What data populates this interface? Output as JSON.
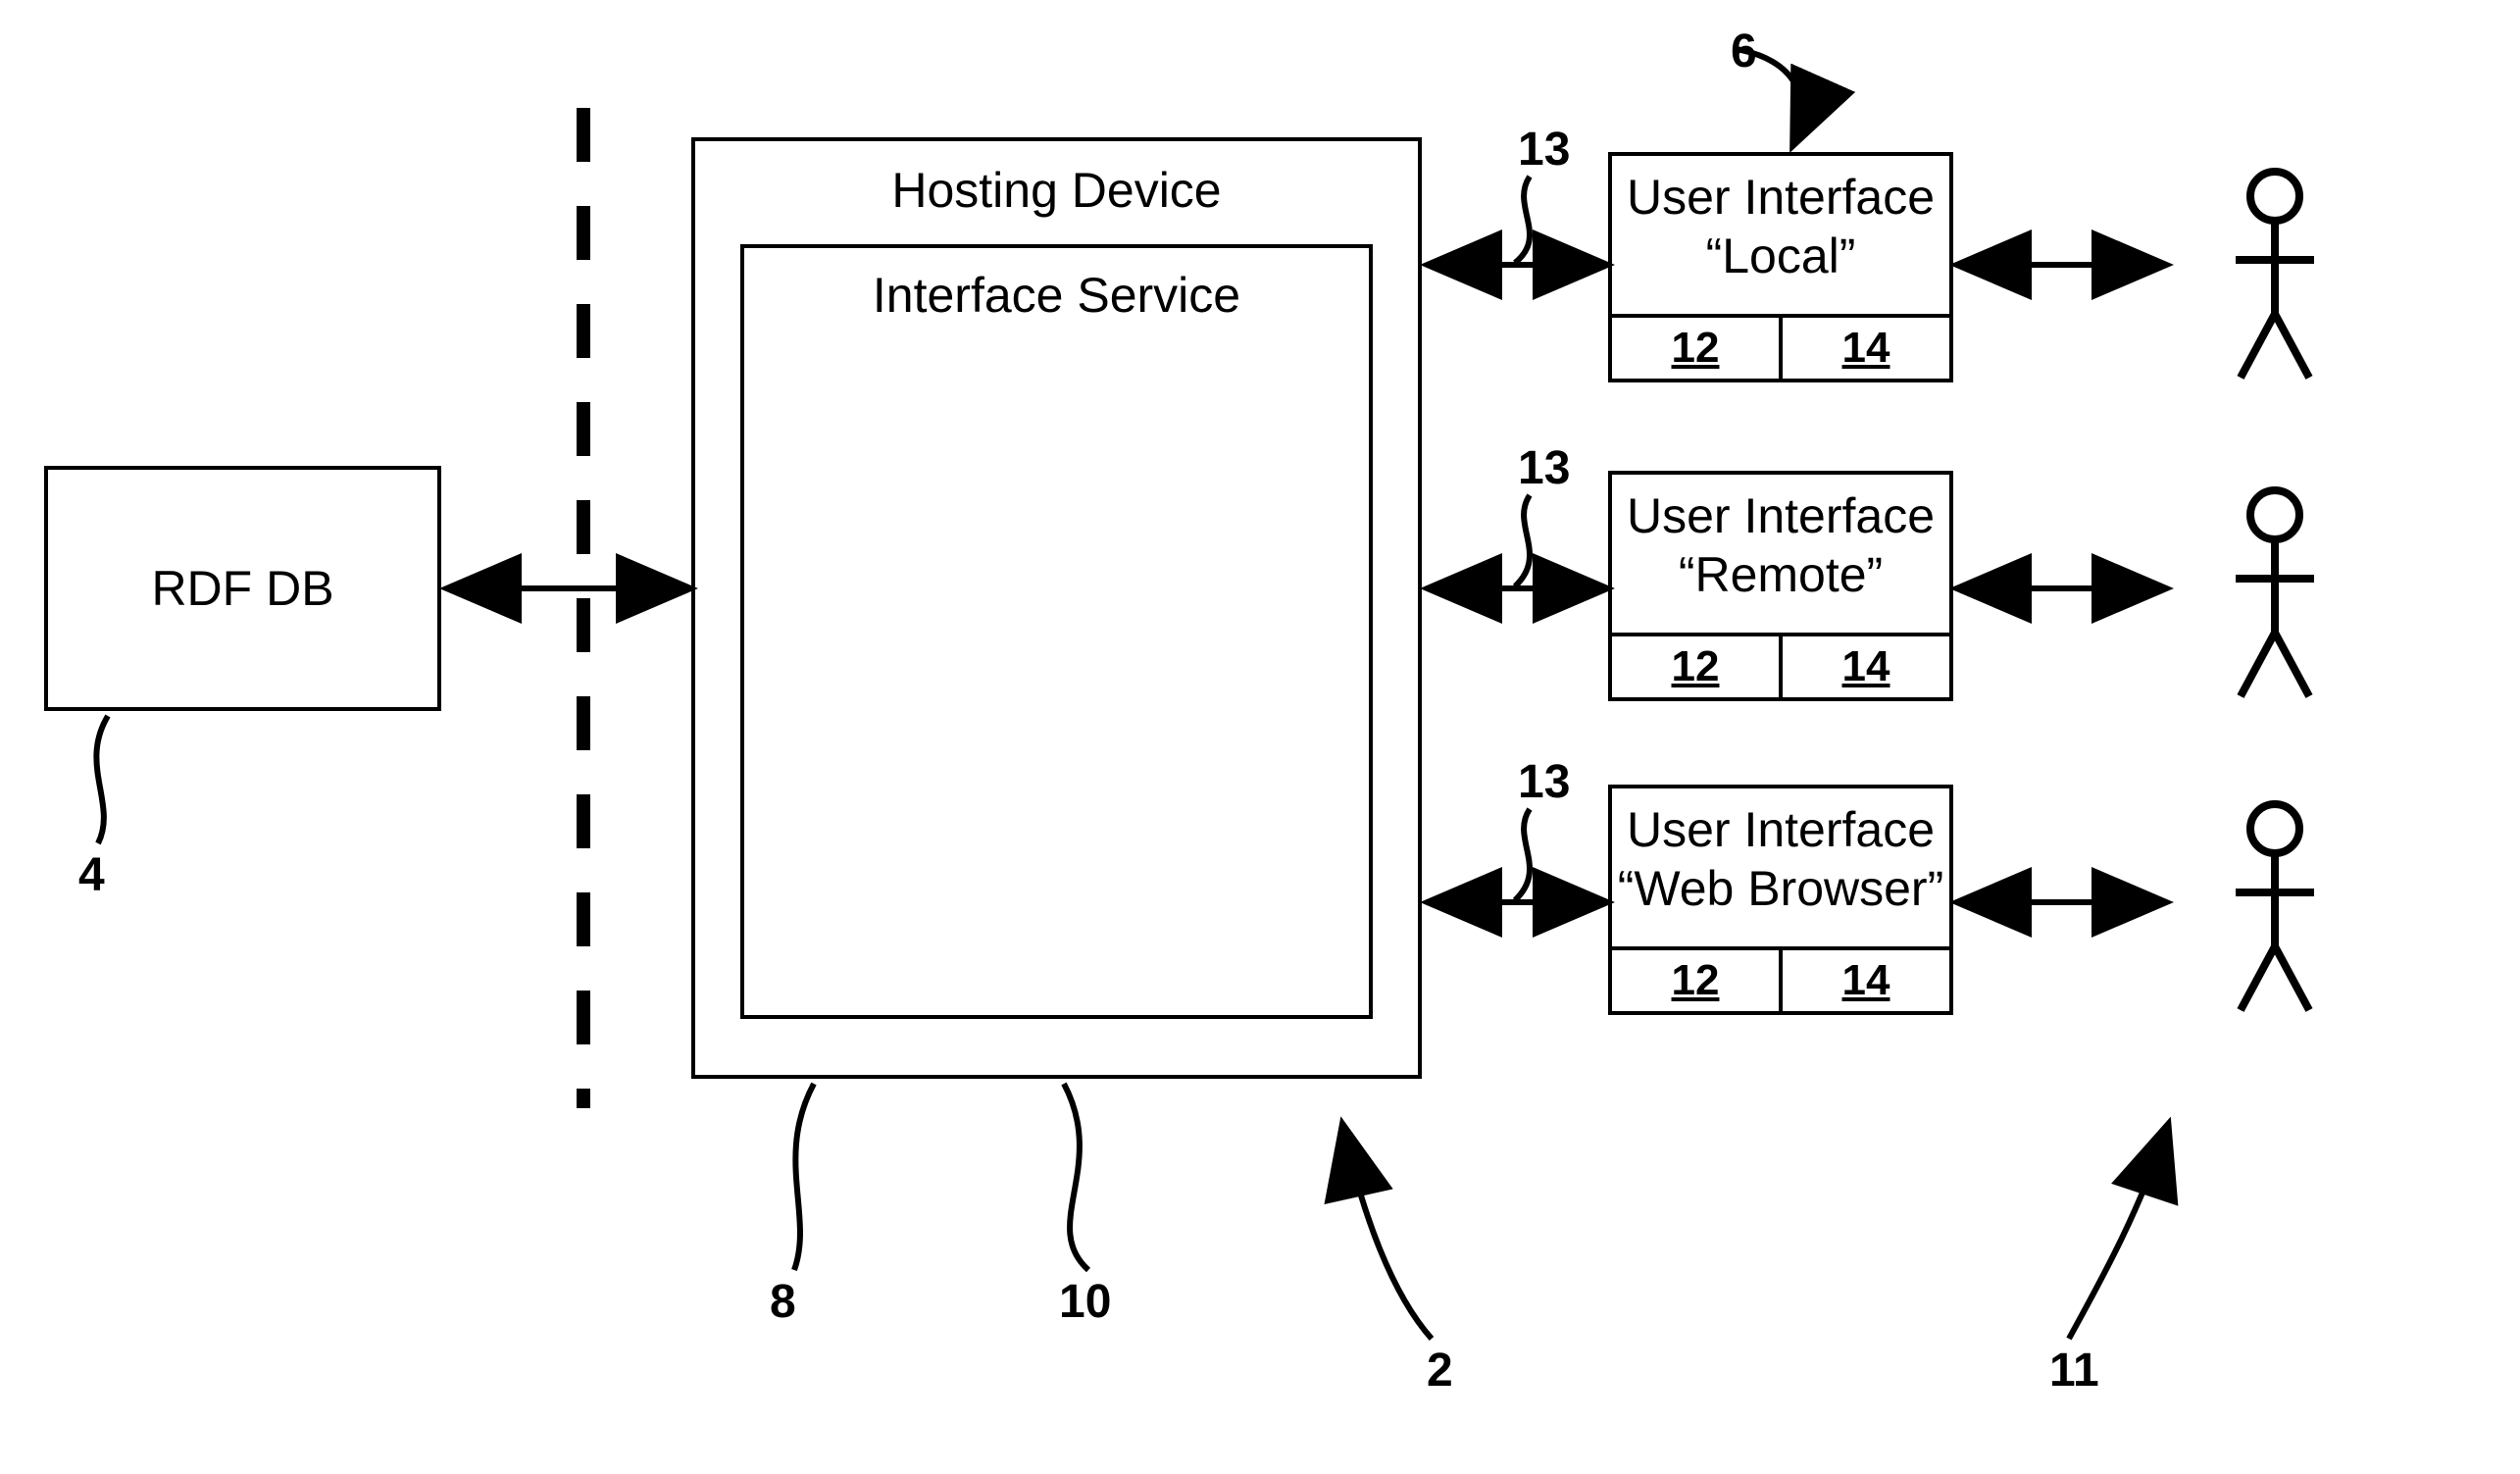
{
  "boxes": {
    "rdf_db": "RDF DB",
    "hosting_device": "Hosting Device",
    "interface_service": "Interface Service",
    "ui_local_line1": "User Interface",
    "ui_local_line2": "“Local”",
    "ui_remote_line1": "User Interface",
    "ui_remote_line2": "“Remote”",
    "ui_web_line1": "User Interface",
    "ui_web_line2": "“Web Browser”",
    "cell12": "12",
    "cell14": "14"
  },
  "refs": {
    "r2": "2",
    "r4": "4",
    "r6": "6",
    "r8": "8",
    "r10": "10",
    "r11": "11",
    "r13": "13"
  }
}
